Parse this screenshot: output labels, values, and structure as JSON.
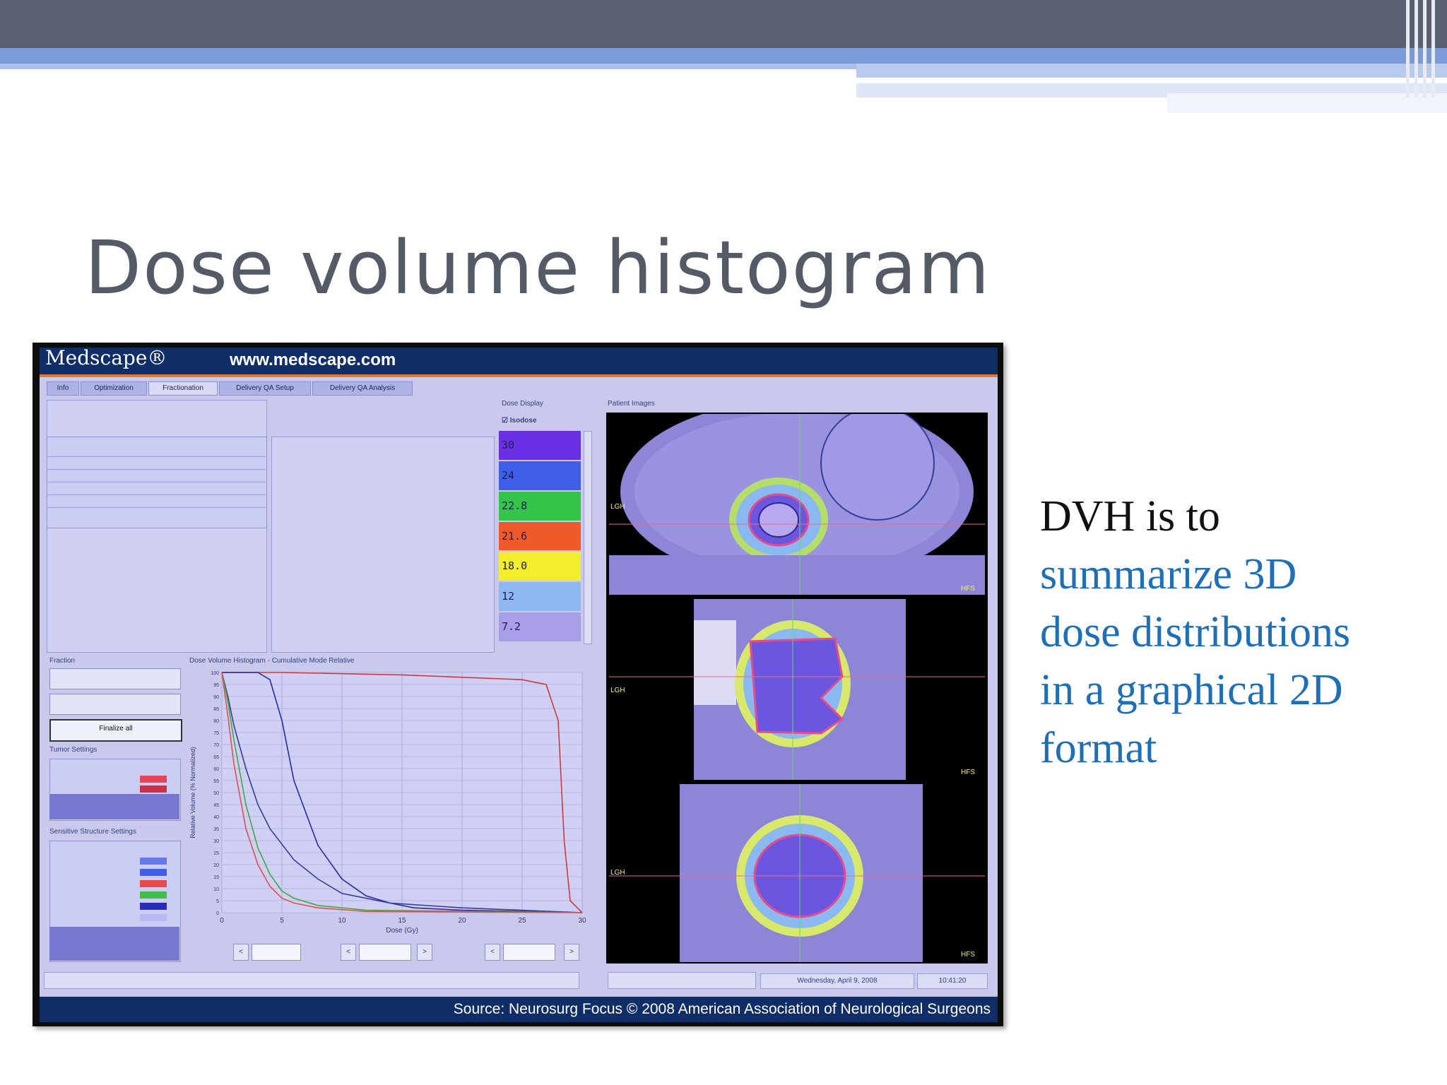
{
  "slide": {
    "title": "Dose volume histogram",
    "text_intro": "DVH is to",
    "text_lines": [
      "summarize 3D",
      "dose distributions",
      "in a graphical 2D",
      "format"
    ],
    "colors": {
      "title": "#545a66",
      "accent_text": "#1f6fb6",
      "header_band": "#5a6070",
      "accent_band": "#7b9ad8"
    }
  },
  "screenshot": {
    "brand": "Medscape®",
    "url": "www.medscape.com",
    "source": "Source: Neurosurg Focus © 2008 American Association of Neurological Surgeons",
    "tabs": [
      "Info",
      "Optimization",
      "Fractionation",
      "Delivery QA Setup",
      "Delivery QA Analysis"
    ],
    "active_tab": "Fractionation",
    "panels": {
      "dose_display": "Dose Display",
      "isodose_checkbox": "Isodose",
      "patient_images": "Patient Images",
      "fraction_panel": "Fraction",
      "finalize_button": "Finalize all",
      "tumor_settings": "Tumor Settings",
      "sensitive_settings": "Sensitive Structure Settings",
      "dvh_title": "Dose Volume Histogram - Cumulative Mode Relative",
      "x_axis_label": "Dose (Gy)",
      "y_axis_label": "Relative Volume (% Normalized)",
      "date": "Wednesday, April 9, 2008",
      "time": "10:41:20"
    },
    "isodose_levels": [
      {
        "label": "30",
        "color": "#6b2fe6"
      },
      {
        "label": "24",
        "color": "#3f5fe8"
      },
      {
        "label": "22.8",
        "color": "#35c44a"
      },
      {
        "label": "21.6",
        "color": "#f05a2a"
      },
      {
        "label": "18.0",
        "color": "#f2ee2c"
      },
      {
        "label": "12",
        "color": "#8fb7f2"
      },
      {
        "label": "7.2",
        "color": "#a99ee8"
      }
    ],
    "view_labels": [
      "LGH",
      "LGH",
      "LGH"
    ],
    "view_corner_labels": [
      "HFS",
      "HFS",
      "HFS"
    ]
  },
  "chart_data": {
    "type": "line",
    "title": "Dose Volume Histogram - Cumulative Mode Relative",
    "xlabel": "Dose (Gy)",
    "ylabel": "Relative Volume (% Normalized)",
    "xlim": [
      0,
      30
    ],
    "ylim": [
      0,
      100
    ],
    "x_ticks": [
      0,
      5,
      10,
      15,
      20,
      25,
      30
    ],
    "y_ticks": [
      0,
      5,
      10,
      15,
      20,
      25,
      30,
      35,
      40,
      45,
      50,
      55,
      60,
      65,
      70,
      75,
      80,
      85,
      90,
      95,
      100
    ],
    "grid": true,
    "series": [
      {
        "color": "#d03a3a",
        "x": [
          0,
          5,
          10,
          15,
          20,
          25,
          27,
          28,
          28.5,
          29,
          30
        ],
        "y": [
          100,
          100,
          99.5,
          99,
          98,
          97,
          95,
          80,
          30,
          5,
          0
        ]
      },
      {
        "color": "#2a2aa8",
        "x": [
          0,
          3,
          4,
          5,
          6,
          8,
          10,
          12,
          14,
          16,
          20,
          30
        ],
        "y": [
          100,
          100,
          97,
          80,
          55,
          28,
          14,
          7,
          4,
          2,
          1,
          0
        ]
      },
      {
        "color": "#3a3a9a",
        "x": [
          0,
          0.5,
          1,
          2,
          3,
          4,
          6,
          8,
          10,
          14,
          20,
          30
        ],
        "y": [
          100,
          90,
          78,
          60,
          45,
          35,
          22,
          14,
          8,
          4,
          2,
          0
        ]
      },
      {
        "color": "#3faa3f",
        "x": [
          0,
          0.5,
          1,
          2,
          3,
          4,
          5,
          6,
          8,
          12,
          30
        ],
        "y": [
          100,
          88,
          72,
          45,
          27,
          16,
          9,
          6,
          3,
          1,
          0
        ]
      },
      {
        "color": "#e05050",
        "x": [
          0,
          0.5,
          1,
          2,
          3,
          4,
          5,
          6,
          8,
          12,
          30
        ],
        "y": [
          100,
          82,
          62,
          35,
          20,
          11,
          6,
          4,
          2,
          0.5,
          0
        ]
      }
    ]
  }
}
